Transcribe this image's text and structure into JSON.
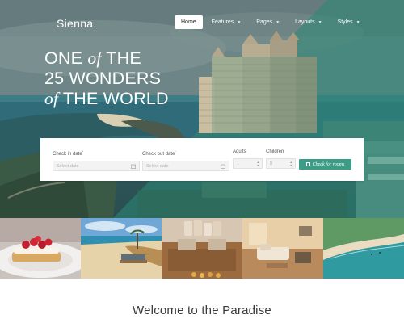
{
  "brand": {
    "logo_text": "Sienna"
  },
  "nav": {
    "items": [
      {
        "label": "Home",
        "active": true,
        "has_dropdown": false
      },
      {
        "label": "Features",
        "active": false,
        "has_dropdown": true
      },
      {
        "label": "Pages",
        "active": false,
        "has_dropdown": true
      },
      {
        "label": "Layouts",
        "active": false,
        "has_dropdown": true
      },
      {
        "label": "Styles",
        "active": false,
        "has_dropdown": true
      }
    ]
  },
  "hero": {
    "line1_a": "ONE ",
    "line1_b": "of",
    "line1_c": " THE",
    "line2": "25 WONDERS",
    "line3_a": "of",
    "line3_b": " THE WORLD"
  },
  "booking": {
    "checkin_label": "Check in date",
    "checkin_placeholder": "Select date",
    "checkout_label": "Check out date",
    "checkout_placeholder": "Select date",
    "adults_label": "Adults",
    "adults_value": "1",
    "children_label": "Children",
    "children_value": "0",
    "required_mark": "*",
    "submit_label": "Check for rooms"
  },
  "gallery": {
    "tiles": [
      "dessert-photo",
      "beach-photo",
      "lounge-photo",
      "hotel-room-photo",
      "aerial-coast-photo"
    ]
  },
  "welcome": {
    "title": "Welcome to the Paradise"
  },
  "colors": {
    "accent": "#3d9c86",
    "overlay_teal": "#2c8a76",
    "text_dark": "#3a3a3a"
  }
}
